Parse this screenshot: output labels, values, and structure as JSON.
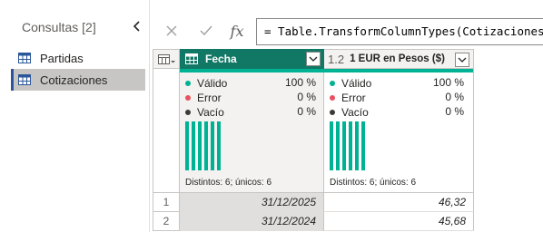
{
  "sidebar": {
    "title": "Consultas [2]",
    "collapse_icon": "chevron-left-icon",
    "items": [
      {
        "label": "Partidas",
        "icon": "table-icon",
        "selected": false
      },
      {
        "label": "Cotizaciones",
        "icon": "table-icon",
        "selected": true
      }
    ]
  },
  "formula_bar": {
    "cancel_icon": "close-icon",
    "commit_icon": "check-icon",
    "fx_label": "fx",
    "formula": "= Table.TransformColumnTypes(Cotizaciones_Tabl"
  },
  "grid": {
    "columns": [
      {
        "type_label": "",
        "type_icon": "calendar-table-icon",
        "name": "Fecha",
        "selected": true,
        "profile": {
          "valid_label": "Válido",
          "valid_pct": "100 %",
          "error_label": "Error",
          "error_pct": "0 %",
          "empty_label": "Vacío",
          "empty_pct": "0 %",
          "histogram": [
            1,
            1,
            1,
            1,
            1,
            1
          ],
          "footer": "Distintos: 6; únicos: 6"
        }
      },
      {
        "type_label": "1.2",
        "type_icon": "decimal-type-icon",
        "name": "1 EUR en Pesos ($)",
        "selected": false,
        "profile": {
          "valid_label": "Válido",
          "valid_pct": "100 %",
          "error_label": "Error",
          "error_pct": "0 %",
          "empty_label": "Vacío",
          "empty_pct": "0 %",
          "histogram": [
            1,
            1,
            1,
            1,
            1,
            1
          ],
          "footer": "Distintos: 6; únicos: 6"
        }
      }
    ],
    "rows": [
      {
        "num": "1",
        "fecha": "31/12/2025",
        "valor": "46,32"
      },
      {
        "num": "2",
        "fecha": "31/12/2024",
        "valor": "45,68"
      }
    ]
  },
  "colors": {
    "selected_header": "#117865",
    "quality_valid": "#00b294",
    "quality_error": "#e8525f",
    "quality_empty": "#3b3a39",
    "sidebar_selected": "#c8c6c4"
  }
}
